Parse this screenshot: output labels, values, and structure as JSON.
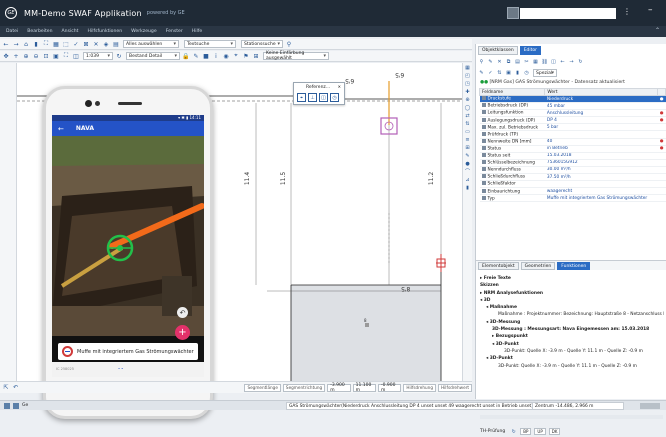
{
  "titlebar": {
    "logo": "GE",
    "title": "MM-Demo SWAF Applikation",
    "powered": "powered by GE"
  },
  "menu": [
    "Datei",
    "Bearbeiten",
    "Ansicht",
    "Hilfsfunktionen",
    "Werkzeuge",
    "Fenster",
    "Hilfe"
  ],
  "toolbar1": {
    "select_all": "Alles auswählen",
    "text_search": "Textsuche",
    "station_search": "Stationssuche"
  },
  "toolbar2": {
    "scale": "1:039",
    "inventory": "Bestand Detail",
    "no_setting": "Keine Einfärbung ausgewählt"
  },
  "map": {
    "dim_top_left": "6'5",
    "dim_top_right": "6'5",
    "dim_right": "8'5",
    "dim_v1": "11.4",
    "dim_v2": "11.5",
    "dim_v3": "11.2",
    "small_label": "8"
  },
  "ref_popup": {
    "title": "Referenz..."
  },
  "phone": {
    "status": "▾ ✱ ▮ 14:11",
    "app_title": "NAVA",
    "card_text": "Muffe mit integriertem Gas Strömungswächter",
    "photo_id": "IC 258025",
    "page_dots": "• •"
  },
  "coordbar": {
    "segment1": "Segmentlänge",
    "segment2": "Segmentrichtung",
    "val1": "-3.900 m",
    "val2": "11.100 m",
    "val3": "-0.900 m",
    "help1": "Hilfsdrehung",
    "help2": "Hilfsdrehwert"
  },
  "status": {
    "prefix": "Ge",
    "text": "GAS Strömungswächter(Niederdruck Anschlussleitung DP 4 unset unset 49 waagerecht unset in Betrieb unset) 8 P..",
    "coords": "Zentrum -14.486, 2.966 m"
  },
  "panel": {
    "tabs": [
      "Objektklassen",
      "Editor"
    ],
    "active_tab": "Editor",
    "spezial": "Spezial",
    "info": "[NRM Gas] GAS Strömungswächter - Datensatz aktualisiert",
    "table_headers": [
      "Feldname",
      "Wert"
    ],
    "rows": [
      {
        "field": "Druckstufe",
        "value": "Niederdruck",
        "hl": true,
        "flag": "●"
      },
      {
        "field": "Betriebsdruck (DP)",
        "value": "45 mbar",
        "hl": false,
        "flag": ""
      },
      {
        "field": "Leitungsfunktion",
        "value": "Anschlussleitung",
        "hl": false,
        "flag": "●"
      },
      {
        "field": "Auslegungsdruck (DP)",
        "value": "DP 4",
        "hl": false,
        "flag": "●"
      },
      {
        "field": "Max. zul. Betriebsdruck",
        "value": "5 bar",
        "hl": false,
        "flag": ""
      },
      {
        "field": "Prüfdruck (TP)",
        "value": "",
        "hl": false,
        "flag": ""
      },
      {
        "field": "Nennweite DN [mm]",
        "value": "40",
        "hl": false,
        "flag": "●"
      },
      {
        "field": "Status",
        "value": "in Betrieb",
        "hl": false,
        "flag": "●"
      },
      {
        "field": "Status seit",
        "value": "15.03.2018",
        "hl": false,
        "flag": ""
      },
      {
        "field": "Schlüsselbezeichnung",
        "value": "7536015G912",
        "hl": false,
        "flag": ""
      },
      {
        "field": "Nenndurchfluss",
        "value": "30.00 m³/h",
        "hl": false,
        "flag": ""
      },
      {
        "field": "Schließdurchfluss",
        "value": "37.50 m³/h",
        "hl": false,
        "flag": ""
      },
      {
        "field": "Schließfaktor",
        "value": "",
        "hl": false,
        "flag": ""
      },
      {
        "field": "Einbaurichtung",
        "value": "waagerecht",
        "hl": false,
        "flag": ""
      },
      {
        "field": "Typ",
        "value": "Muffe mit integriertem Gas Strömungswächter",
        "hl": false,
        "flag": ""
      }
    ],
    "lower_tabs": [
      "Elementobjekt",
      "Geometrien",
      "Funktionen"
    ],
    "lower_active": "Funktionen",
    "tree": [
      {
        "level": "t1",
        "text": "▸ Freie Texte"
      },
      {
        "level": "t1",
        "text": "Skizzen"
      },
      {
        "level": "t1",
        "text": "▸ NRM Analysefunktionen"
      },
      {
        "level": "t1",
        "text": "◂ 3D"
      },
      {
        "level": "t2",
        "text": "◂ Maßnahme"
      },
      {
        "level": "t4",
        "text": "Maßnahme : Projektnummer: Bezeichnung: Hauptstraße 8 - Netzanschluss NNS: 44, Ortsteil:"
      },
      {
        "level": "t2",
        "text": "◂ 3D-Messung"
      },
      {
        "level": "t3",
        "text": "3D-Messung : Messungsart: Nava Eingemessen am: 15.03.2018"
      },
      {
        "level": "t3",
        "text": "▸ Bezugspunkt"
      },
      {
        "level": "t3",
        "text": "◂ 3D-Punkt"
      },
      {
        "level": "t5",
        "text": "3D-Punkt: Quelle X: -3.9 m - Quelle Y: 11.1 m - Quelle Z: -0.9 m"
      },
      {
        "level": "t2",
        "text": "◂ 3D-Punkt"
      },
      {
        "level": "t4",
        "text": "3D-Punkt: Quelle X: -3.9 m - Quelle Y: 11.1 m - Quelle Z: -0.9 m"
      }
    ],
    "bottom": {
      "label": "TH-Prüfung",
      "btn1": "BP",
      "btn2": "UP",
      "btn3": "DK"
    }
  }
}
